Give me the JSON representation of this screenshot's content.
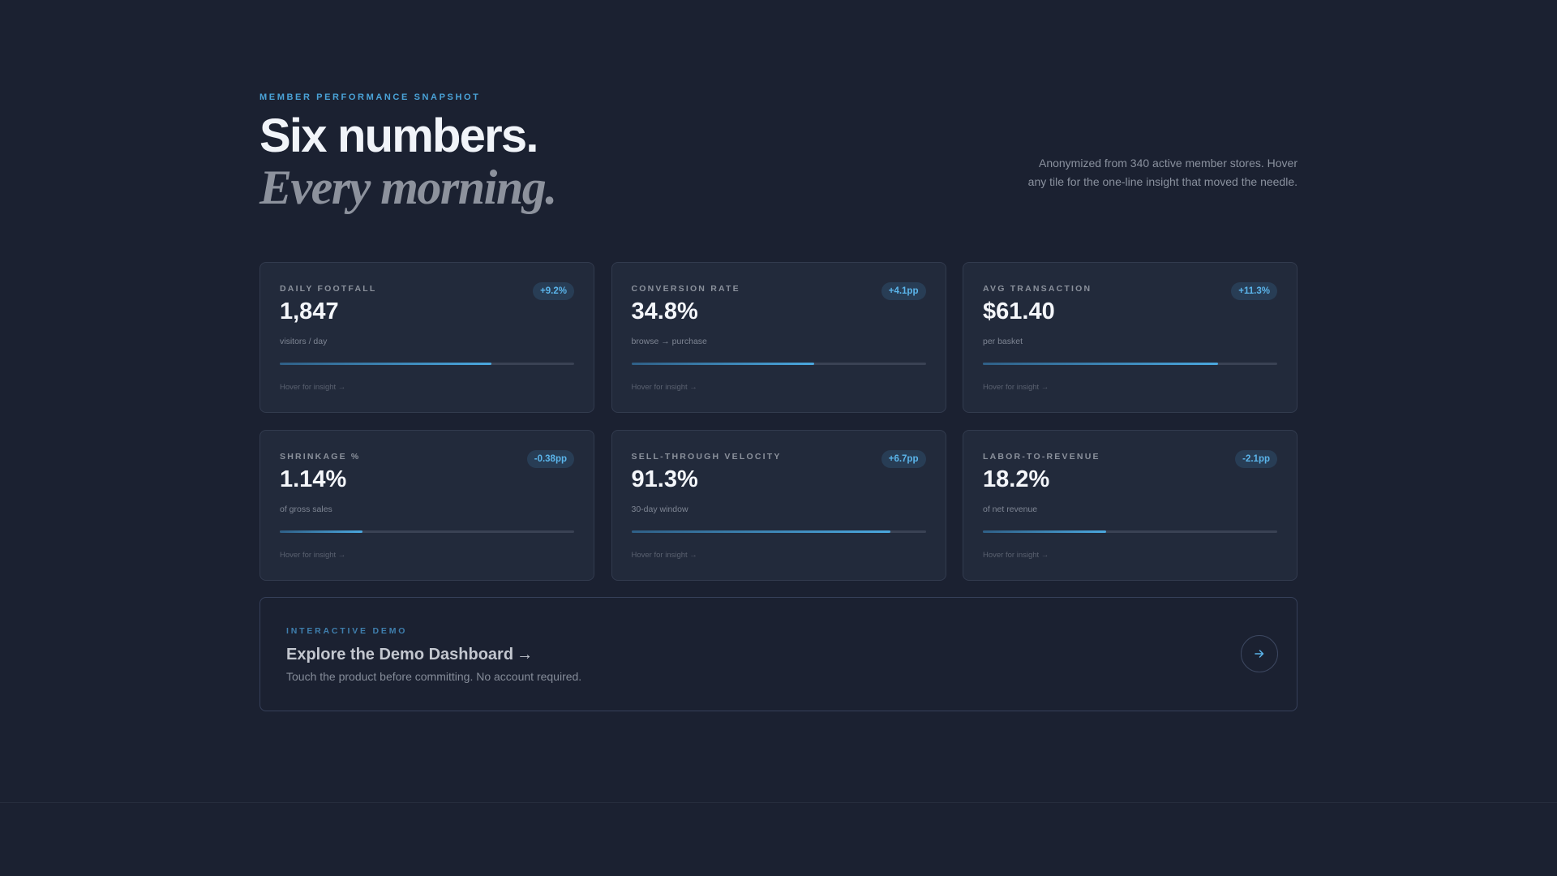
{
  "header": {
    "eyebrow": "MEMBER PERFORMANCE SNAPSHOT",
    "title": "Six numbers.",
    "subtitle": "Every morning.",
    "intro": "Anonymized from 340 active member stores. Hover any tile for the one-line insight that moved the needle."
  },
  "colors": {
    "background": "#1b2131",
    "tile": "#222a3b",
    "accent": "#4aa7de",
    "badge_bg": "#283d55"
  },
  "tiles": [
    {
      "label": "DAILY FOOTFALL",
      "value": "1,847",
      "unit": "visitors / day",
      "badge": "+9.2%",
      "progress": 0.72,
      "hint": "Hover for insight →"
    },
    {
      "label": "CONVERSION RATE",
      "value": "34.8%",
      "unit": "browse → purchase",
      "badge": "+4.1pp",
      "progress": 0.62,
      "hint": "Hover for insight →"
    },
    {
      "label": "AVG TRANSACTION",
      "value": "$61.40",
      "unit": "per basket",
      "badge": "+11.3%",
      "progress": 0.8,
      "hint": "Hover for insight →"
    },
    {
      "label": "SHRINKAGE %",
      "value": "1.14%",
      "unit": "of gross sales",
      "badge": "-0.38pp",
      "progress": 0.28,
      "hint": "Hover for insight →"
    },
    {
      "label": "SELL-THROUGH VELOCITY",
      "value": "91.3%",
      "unit": "30-day window",
      "badge": "+6.7pp",
      "progress": 0.88,
      "hint": "Hover for insight →"
    },
    {
      "label": "LABOR-TO-REVENUE",
      "value": "18.2%",
      "unit": "of net revenue",
      "badge": "-2.1pp",
      "progress": 0.42,
      "hint": "Hover for insight →"
    }
  ],
  "demo": {
    "eyebrow": "INTERACTIVE DEMO",
    "title": "Explore the Demo Dashboard",
    "title_arrow": "→",
    "subtitle": "Touch the product before committing. No account required.",
    "button_icon": "arrow-right-icon"
  }
}
